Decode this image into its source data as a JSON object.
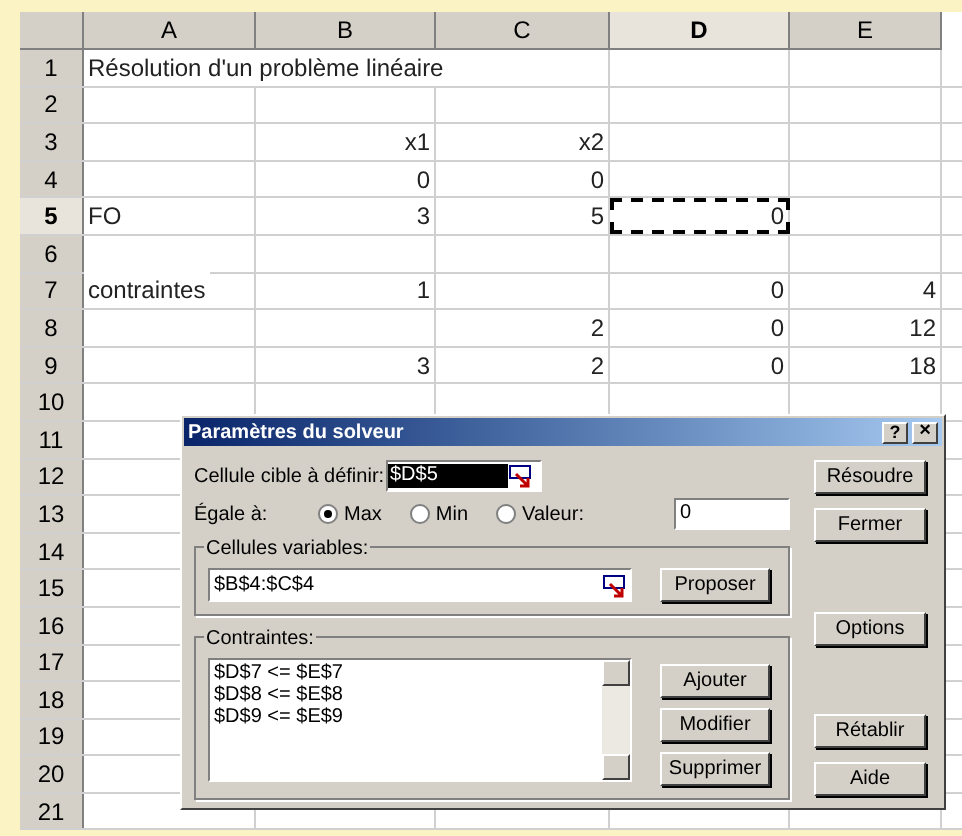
{
  "sheet": {
    "columns": [
      {
        "label": "A",
        "selected": false
      },
      {
        "label": "B",
        "selected": false
      },
      {
        "label": "C",
        "selected": false
      },
      {
        "label": "D",
        "selected": true
      },
      {
        "label": "E",
        "selected": false
      }
    ],
    "rows": [
      {
        "number": "1",
        "selected": false,
        "cells": [
          {
            "kind": "label",
            "text": "Résolution d'un problème linéaire"
          },
          null,
          null,
          null,
          null
        ]
      },
      {
        "number": "2",
        "selected": false,
        "cells": [
          null,
          null,
          null,
          null,
          null
        ]
      },
      {
        "number": "3",
        "selected": false,
        "cells": [
          null,
          {
            "kind": "number",
            "text": "x1"
          },
          {
            "kind": "number",
            "text": "x2"
          },
          null,
          null
        ]
      },
      {
        "number": "4",
        "selected": false,
        "cells": [
          null,
          {
            "kind": "number",
            "text": "0"
          },
          {
            "kind": "number",
            "text": "0"
          },
          null,
          null
        ]
      },
      {
        "number": "5",
        "selected": true,
        "cells": [
          {
            "kind": "label",
            "text": "FO"
          },
          {
            "kind": "number",
            "text": "3"
          },
          {
            "kind": "number",
            "text": "5"
          },
          {
            "kind": "number",
            "text": "0",
            "selected": true
          },
          null
        ]
      },
      {
        "number": "6",
        "selected": false,
        "cells": [
          null,
          null,
          null,
          null,
          null
        ]
      },
      {
        "number": "7",
        "selected": false,
        "cells": [
          {
            "kind": "label",
            "text": "contraintes"
          },
          {
            "kind": "number",
            "text": "1"
          },
          null,
          {
            "kind": "number",
            "text": "0"
          },
          {
            "kind": "number",
            "text": "4"
          }
        ]
      },
      {
        "number": "8",
        "selected": false,
        "cells": [
          null,
          null,
          {
            "kind": "number",
            "text": "2"
          },
          {
            "kind": "number",
            "text": "0"
          },
          {
            "kind": "number",
            "text": "12"
          }
        ]
      },
      {
        "number": "9",
        "selected": false,
        "cells": [
          null,
          {
            "kind": "number",
            "text": "3"
          },
          {
            "kind": "number",
            "text": "2"
          },
          {
            "kind": "number",
            "text": "0"
          },
          {
            "kind": "number",
            "text": "18"
          }
        ]
      },
      {
        "number": "10",
        "selected": false,
        "cells": [
          null,
          null,
          null,
          null,
          null
        ]
      },
      {
        "number": "11",
        "selected": false,
        "cells": [
          null,
          null,
          null,
          null,
          null
        ]
      },
      {
        "number": "12",
        "selected": false,
        "cells": [
          null,
          null,
          null,
          null,
          null
        ]
      },
      {
        "number": "13",
        "selected": false,
        "cells": [
          null,
          null,
          null,
          null,
          null
        ]
      },
      {
        "number": "14",
        "selected": false,
        "cells": [
          null,
          null,
          null,
          null,
          null
        ]
      },
      {
        "number": "15",
        "selected": false,
        "cells": [
          null,
          null,
          null,
          null,
          null
        ]
      },
      {
        "number": "16",
        "selected": false,
        "cells": [
          null,
          null,
          null,
          null,
          null
        ]
      },
      {
        "number": "17",
        "selected": false,
        "cells": [
          null,
          null,
          null,
          null,
          null
        ]
      },
      {
        "number": "18",
        "selected": false,
        "cells": [
          null,
          null,
          null,
          null,
          null
        ]
      },
      {
        "number": "19",
        "selected": false,
        "cells": [
          null,
          null,
          null,
          null,
          null
        ]
      },
      {
        "number": "20",
        "selected": false,
        "cells": [
          null,
          null,
          null,
          null,
          null
        ]
      },
      {
        "number": "21",
        "selected": false,
        "cells": [
          null,
          null,
          null,
          null,
          null
        ]
      }
    ]
  },
  "dialog": {
    "title": "Paramètres du solveur",
    "help": "?",
    "close": "×",
    "target_cell": {
      "label": "Cellule cible à définir:",
      "value": "$D$5"
    },
    "equal_to": {
      "label": "Égale à:",
      "options": [
        {
          "label": "Max",
          "selected": true
        },
        {
          "label": "Min",
          "selected": false
        },
        {
          "label": "Valeur:",
          "selected": false
        }
      ],
      "value": "0"
    },
    "variable_cells": {
      "label": "Cellules variables:",
      "value": "$B$4:$C$4",
      "button": "Proposer"
    },
    "constraints": {
      "label": "Contraintes:",
      "items": [
        "$D$7 <= $E$7",
        "$D$8 <= $E$8",
        "$D$9 <= $E$9"
      ],
      "buttons": [
        "Ajouter",
        "Modifier",
        "Supprimer"
      ]
    },
    "side_buttons": [
      [
        "Résoudre",
        "Fermer"
      ],
      [
        "Options"
      ],
      [
        "Rétablir",
        "Aide"
      ]
    ]
  }
}
